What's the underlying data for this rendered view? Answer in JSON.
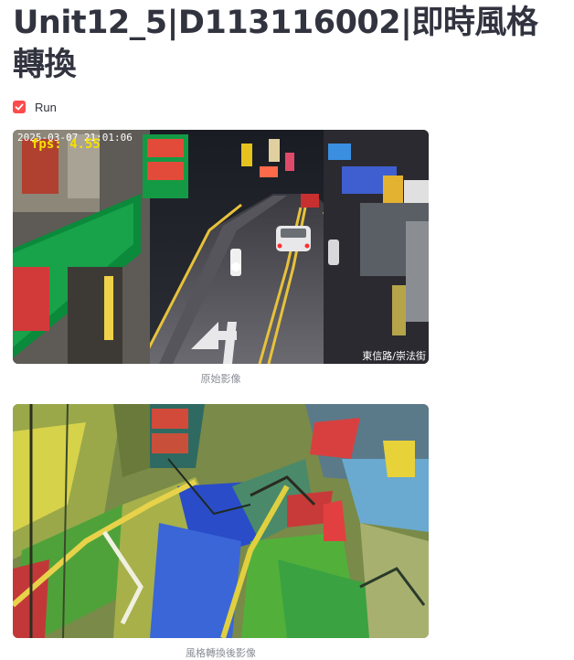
{
  "page": {
    "title": "Unit12_5|D113116002|即時風格轉換"
  },
  "run_toggle": {
    "label": "Run",
    "checked": true
  },
  "original_frame": {
    "fps_text": "fps: 4.55",
    "timestamp_text": "2025-03-07 21:01:06",
    "location_text": "東信路/崇法街",
    "caption": "原始影像"
  },
  "styled_frame": {
    "caption": "風格轉換後影像"
  },
  "colors": {
    "accent": "#ff4b4b",
    "fps_color": "#f5e100",
    "text": "#31333f",
    "caption": "#8a8d96"
  }
}
